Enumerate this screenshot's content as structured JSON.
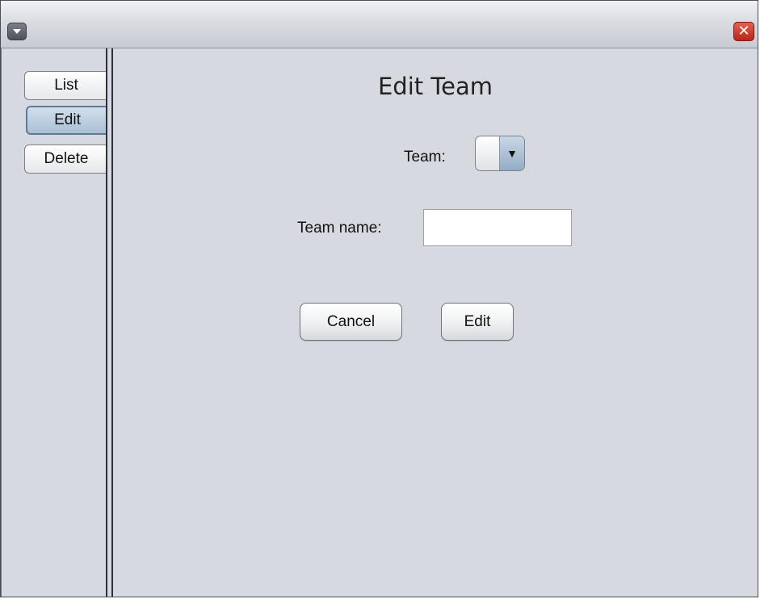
{
  "window": {
    "menu_icon": "dropdown-menu-icon",
    "close_glyph": "✕",
    "close_icon": "close-icon"
  },
  "tabs": [
    {
      "label": "List",
      "selected": false
    },
    {
      "label": "Edit",
      "selected": true
    },
    {
      "label": "Delete",
      "selected": false
    }
  ],
  "panel": {
    "title": "Edit Team",
    "team_label": "Team:",
    "team_selected_value": "",
    "team_arrow_glyph": "▼",
    "team_name_label": "Team name:",
    "team_name_value": "",
    "cancel_label": "Cancel",
    "edit_label": "Edit"
  },
  "colors": {
    "background": "#d6d9df",
    "selected_tab": "#a9c0d5",
    "close_button": "#c2301f"
  }
}
